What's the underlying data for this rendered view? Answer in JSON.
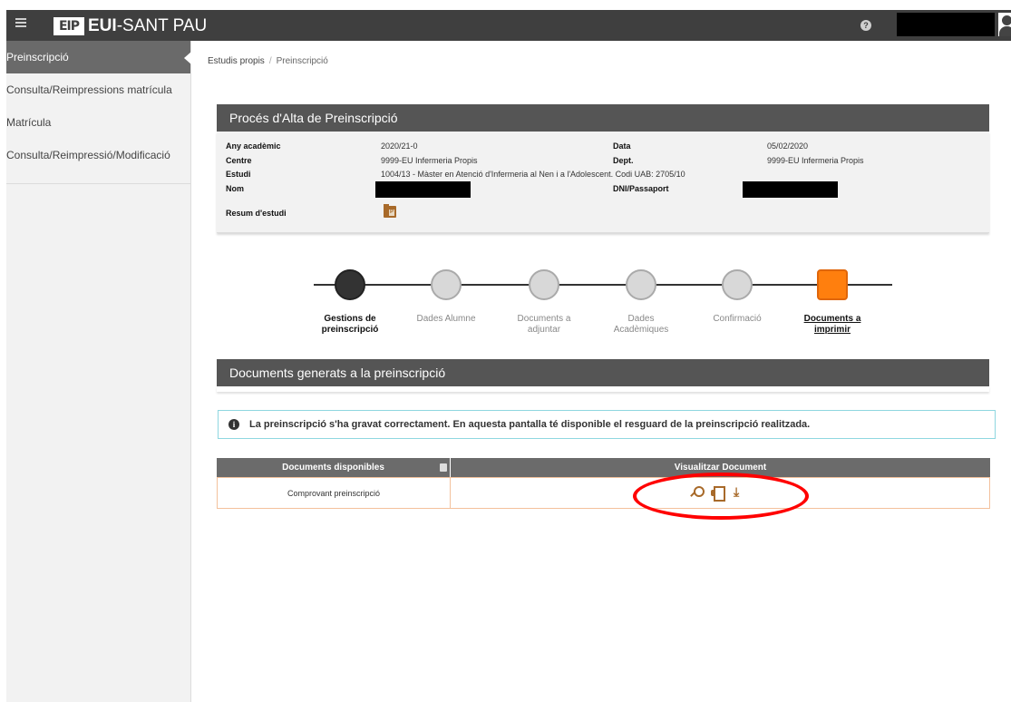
{
  "header": {
    "logo_mark": "EIP",
    "logo_text_bold": "EUI",
    "logo_text_rest": "-SANT PAU",
    "help_icon": "question-circle-icon",
    "colors": {
      "bar": "#3f3f3f"
    }
  },
  "sidebar": {
    "items": [
      {
        "label": "Preinscripció",
        "active": true
      },
      {
        "label": "Consulta/Reimpressions matrícula",
        "active": false
      },
      {
        "label": "Matrícula",
        "active": false
      },
      {
        "label": "Consulta/Reimpressió/Modificació",
        "active": false
      }
    ]
  },
  "breadcrumb": {
    "root": "Estudis propis",
    "separator": "/",
    "current": "Preinscripció"
  },
  "process_panel": {
    "title": "Procés d'Alta de Preinscripció",
    "fields": {
      "any_label": "Any acadèmic",
      "any_value": "2020/21-0",
      "data_label": "Data",
      "data_value": "05/02/2020",
      "centre_label": "Centre",
      "centre_value": "9999-EU Infermeria Propis",
      "dept_label": "Dept.",
      "dept_value": "9999-EU Infermeria Propis",
      "estudi_label": "Estudi",
      "estudi_value": "1004/13 - Màster en Atenció d'Infermeria al Nen i a l'Adolescent. Codi UAB: 2705/10",
      "nom_label": "Nom",
      "dni_label": "DNI/Passaport",
      "resum_label": "Resum d'estudi"
    }
  },
  "steps": [
    {
      "line1": "Gestions de",
      "line2": "preinscripció",
      "state": "done"
    },
    {
      "line1": "Dades Alumne",
      "line2": "",
      "state": "pending"
    },
    {
      "line1": "Documents a",
      "line2": "adjuntar",
      "state": "pending"
    },
    {
      "line1": "Dades",
      "line2": "Acadèmiques",
      "state": "pending"
    },
    {
      "line1": "Confirmació",
      "line2": "",
      "state": "pending"
    },
    {
      "line1": "Documents a",
      "line2": "imprimir",
      "state": "current"
    }
  ],
  "documents_panel": {
    "title": "Documents generats a la preinscripció",
    "alert": "La preinscripció s'ha gravat correctament. En aquesta pantalla té disponible el resguard de la preinscripció realitzada.",
    "table": {
      "headers": [
        "Documents disponibles",
        "Visualitzar Document"
      ],
      "rows": [
        {
          "name": "Comprovant preinscripció",
          "actions": [
            "search-icon",
            "print-icon",
            "download-icon"
          ]
        }
      ]
    }
  },
  "colors": {
    "accent": "#ff7f0e",
    "table_border": "#f3c19c",
    "icon": "#a86a2a",
    "annotation": "#ff0000"
  }
}
